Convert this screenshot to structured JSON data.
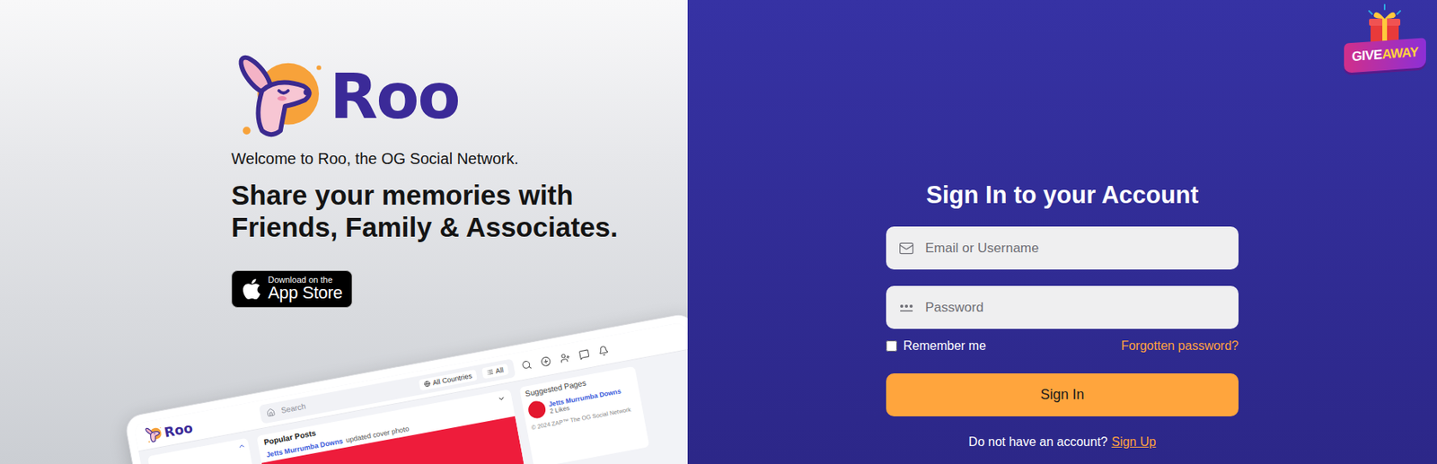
{
  "brand": {
    "name": "Roo"
  },
  "hero": {
    "welcome": "Welcome to Roo, the OG Social Network.",
    "headline": [
      "Share your memories with",
      "Friends, Family & Associates."
    ],
    "app_store": {
      "small": "Download on the",
      "large": "App Store"
    }
  },
  "preview": {
    "logo": "Roo",
    "search": "Search",
    "filters": [
      "All Countries",
      "All"
    ],
    "feed_title": "Popular Posts",
    "post": {
      "author": "Jetts Murrumba Downs",
      "action": "updated cover photo"
    },
    "suggested": {
      "title": "Suggested Pages",
      "pages": [
        {
          "name": "Jetts Murrumba Downs",
          "likes": "2 Likes"
        }
      ]
    },
    "copyright": "© 2024 ZAP™ The OG Social Network"
  },
  "giveaway": {
    "parts": [
      "GIVE",
      "AWAY"
    ]
  },
  "signin": {
    "title": "Sign In to your Account",
    "fields": [
      {
        "placeholder": "Email or Username",
        "kind": "email"
      },
      {
        "placeholder": "Password",
        "kind": "password"
      }
    ],
    "remember": {
      "label": "Remember me",
      "checked": false
    },
    "forgot": "Forgotten password?",
    "button": "Sign In",
    "footer": {
      "text": "Do not have an account?",
      "link": "Sign Up"
    }
  }
}
